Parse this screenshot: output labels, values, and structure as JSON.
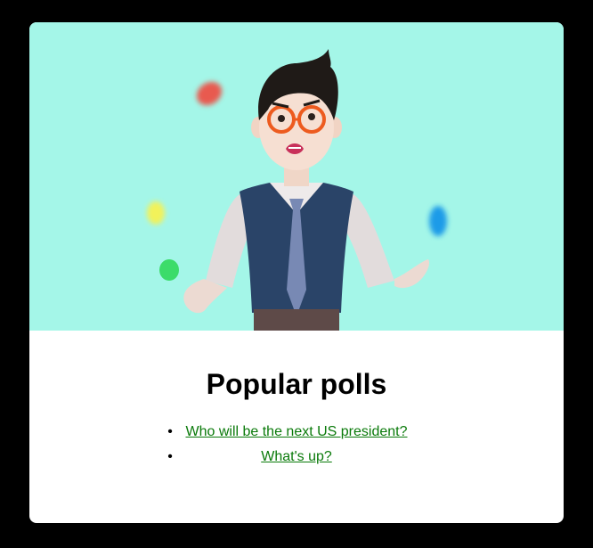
{
  "page": {
    "title": "Popular polls"
  },
  "polls": [
    {
      "label": "Who will be the next US president?"
    },
    {
      "label": "What's up?"
    }
  ],
  "colors": {
    "page_background": "#000000",
    "hero_background": "#a4f6e8",
    "card_background": "#ffffff",
    "link": "#0a7a0a"
  },
  "hero": {
    "illustration": "juggling-man-illustration"
  }
}
